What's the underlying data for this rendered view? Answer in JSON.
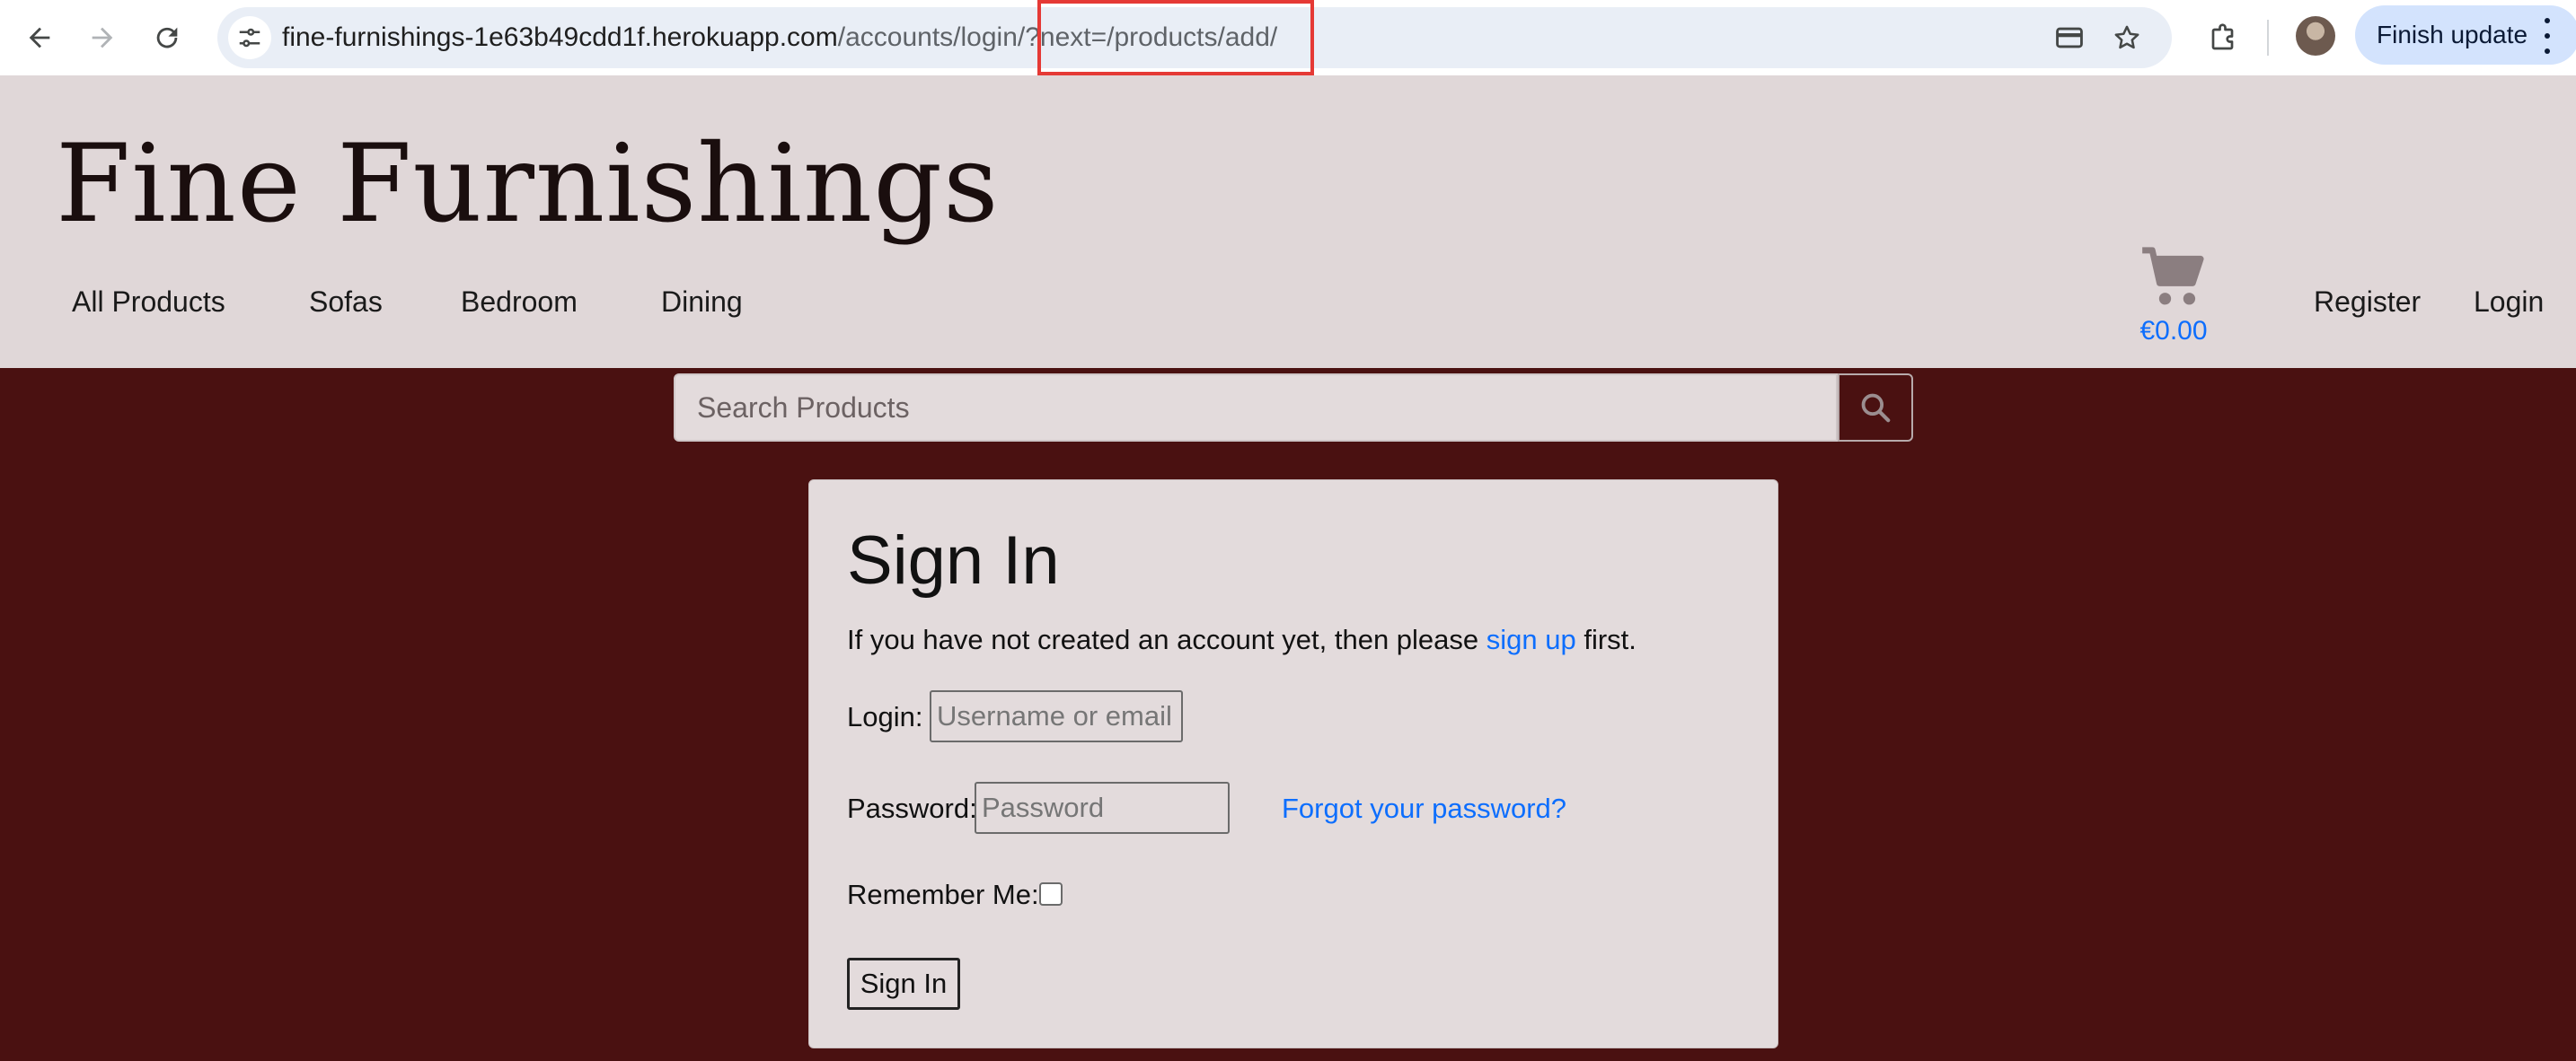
{
  "browser": {
    "url_host": "fine-furnishings-1e63b49cdd1f.herokuapp.com",
    "url_path": "/accounts/login/?next=/products/add/",
    "finish_update_label": "Finish update"
  },
  "header": {
    "brand": "Fine Furnishings",
    "nav": [
      "All Products",
      "Sofas",
      "Bedroom",
      "Dining"
    ],
    "cart_total": "€0.00",
    "account_links": [
      "Register",
      "Login"
    ]
  },
  "search": {
    "placeholder": "Search Products"
  },
  "signin": {
    "title": "Sign In",
    "lead_before": "If you have not created an account yet, then please ",
    "lead_link": "sign up",
    "lead_after": " first.",
    "login_label": "Login:",
    "login_placeholder": "Username or email",
    "password_label": "Password:",
    "password_placeholder": "Password",
    "forgot_link": "Forgot your password?",
    "remember_label": "Remember Me:",
    "remember_checked": false,
    "submit_label": "Sign In"
  },
  "colors": {
    "page_background": "#4a1111",
    "header_background": "#e0d7d8",
    "card_background": "#e3dbdc",
    "link": "#0d6efd",
    "annotation_highlight": "#e53935"
  }
}
